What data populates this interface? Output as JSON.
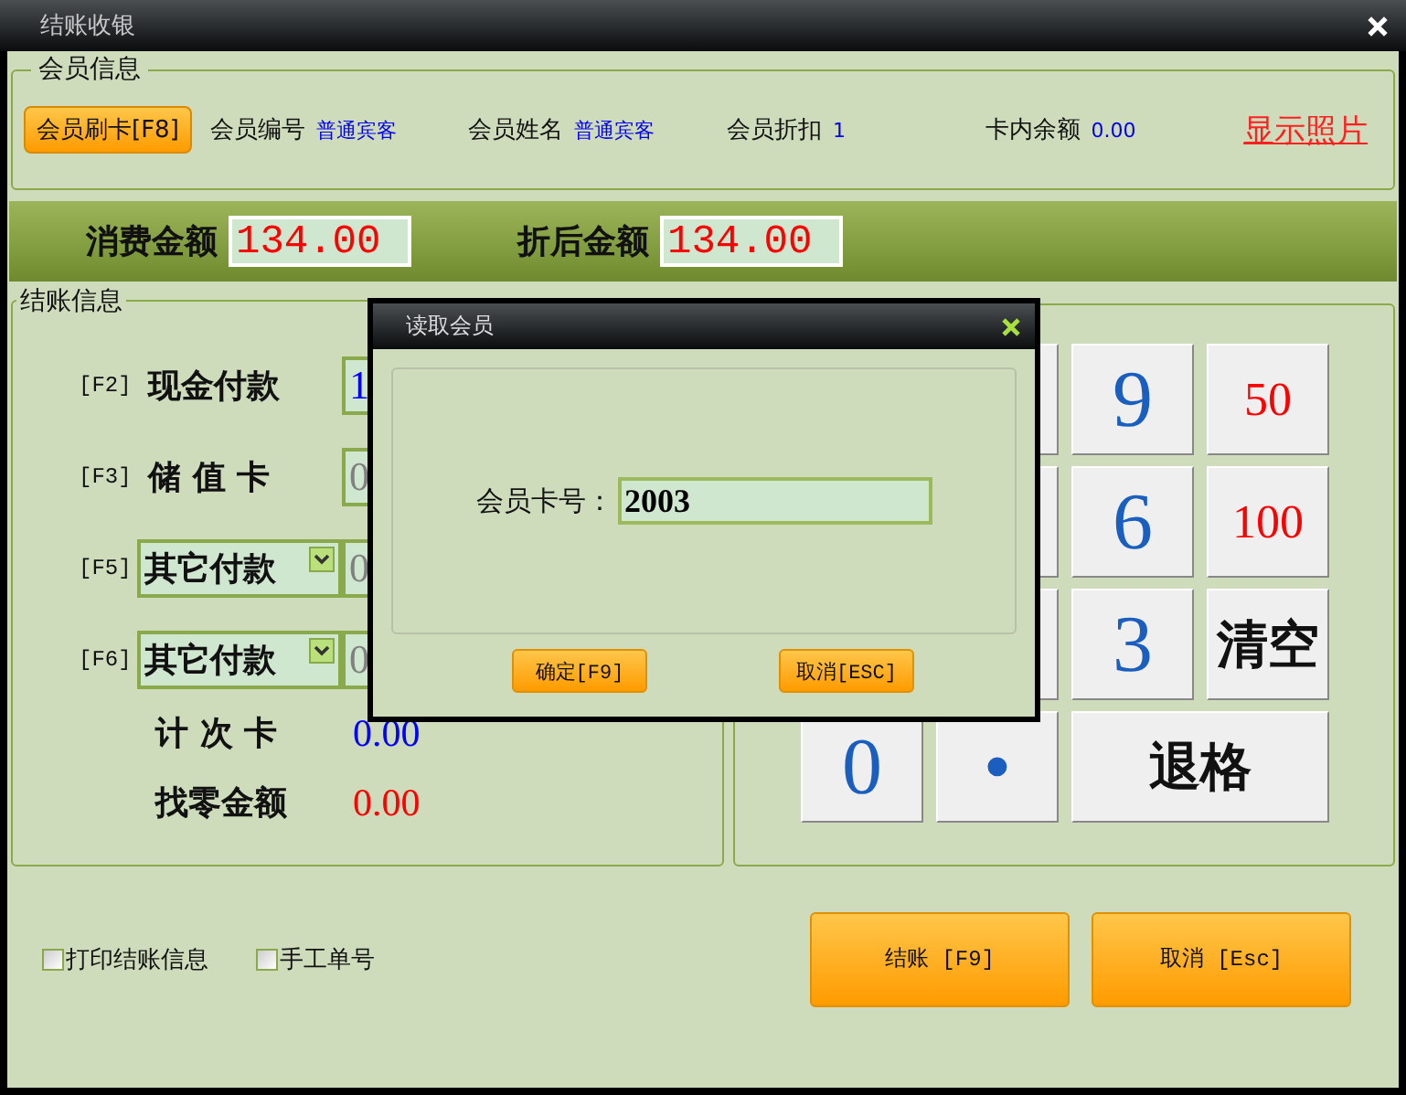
{
  "window": {
    "title": "结账收银"
  },
  "member": {
    "legend": "会员信息",
    "swipe_button": "会员刷卡[F8]",
    "fields": [
      {
        "label": "会员编号",
        "value": "普通宾客"
      },
      {
        "label": "会员姓名",
        "value": "普通宾客"
      },
      {
        "label": "会员折扣",
        "value": "1"
      },
      {
        "label": "卡内余额",
        "value": "0.00"
      }
    ],
    "photo_link": "显示照片"
  },
  "amounts": [
    {
      "label": "消费金额",
      "value": "134.00"
    },
    {
      "label": "折后金额",
      "value": "134.00"
    }
  ],
  "checkout": {
    "legend": "结账信息",
    "payments": [
      {
        "key": "[F2]",
        "label": "现金付款",
        "kind": "fixed",
        "value": "1",
        "color": "#0000ff"
      },
      {
        "key": "[F3]",
        "label": "储 值 卡",
        "kind": "fixed",
        "value": "0",
        "color": "#808080"
      },
      {
        "key": "[F5]",
        "label": "其它付款",
        "kind": "select",
        "value": "0",
        "color": "#808080"
      },
      {
        "key": "[F6]",
        "label": "其它付款",
        "kind": "select",
        "value": "0",
        "color": "#808080"
      }
    ],
    "totals": [
      {
        "label": "计 次 卡",
        "value": "0.00",
        "color": "#0000ff"
      },
      {
        "label": "找零金额",
        "value": "0.00",
        "color": "#ff0000"
      }
    ]
  },
  "keypad": {
    "rows": [
      [
        {
          "kind": "covered"
        },
        {
          "kind": "digit",
          "label": "9"
        },
        {
          "kind": "amount",
          "label": "50"
        }
      ],
      [
        {
          "kind": "covered"
        },
        {
          "kind": "digit",
          "label": "6"
        },
        {
          "kind": "amount",
          "label": "100"
        }
      ],
      [
        {
          "kind": "covered"
        },
        {
          "kind": "digit",
          "label": "3"
        },
        {
          "kind": "action",
          "label": "清空"
        }
      ],
      [
        {
          "kind": "digit",
          "label": "0"
        },
        {
          "kind": "digit",
          "label": "•"
        },
        {
          "kind": "action",
          "label": "退格",
          "wide": true
        }
      ]
    ]
  },
  "options": [
    {
      "label": "打印结账信息",
      "checked": false
    },
    {
      "label": "手工单号",
      "checked": false
    }
  ],
  "buttons": [
    "结账 [F9]",
    "取消 [Esc]"
  ],
  "dialog": {
    "title": "读取会员",
    "field_label": "会员卡号：",
    "value": "2003",
    "buttons": [
      "确定[F9]",
      "取消[ESC]"
    ]
  }
}
